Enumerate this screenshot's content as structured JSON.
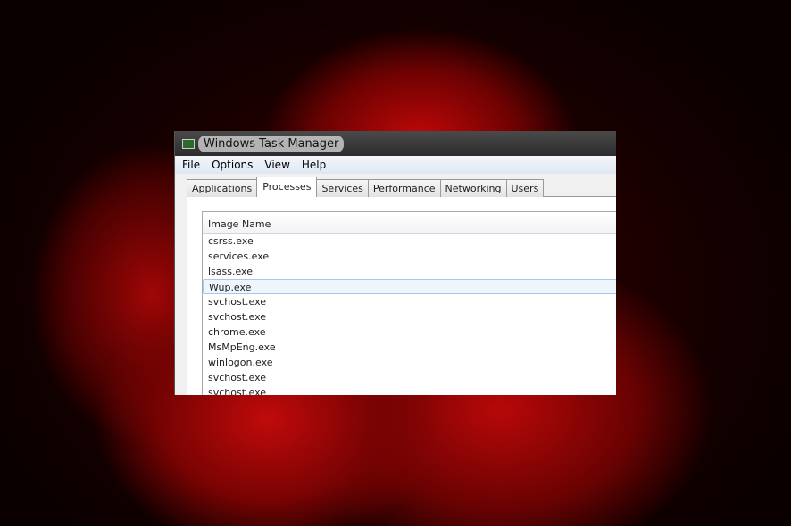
{
  "window": {
    "title": "Windows Task Manager"
  },
  "menu": [
    "File",
    "Options",
    "View",
    "Help"
  ],
  "tabs": [
    "Applications",
    "Processes",
    "Services",
    "Performance",
    "Networking",
    "Users"
  ],
  "list": {
    "header": "Image Name",
    "rows": [
      "csrss.exe",
      "services.exe",
      "lsass.exe",
      "Wup.exe",
      "svchost.exe",
      "svchost.exe",
      "chrome.exe",
      "MsMpEng.exe",
      "winlogon.exe",
      "svchost.exe",
      "svchost.exe"
    ],
    "selected": 3
  }
}
